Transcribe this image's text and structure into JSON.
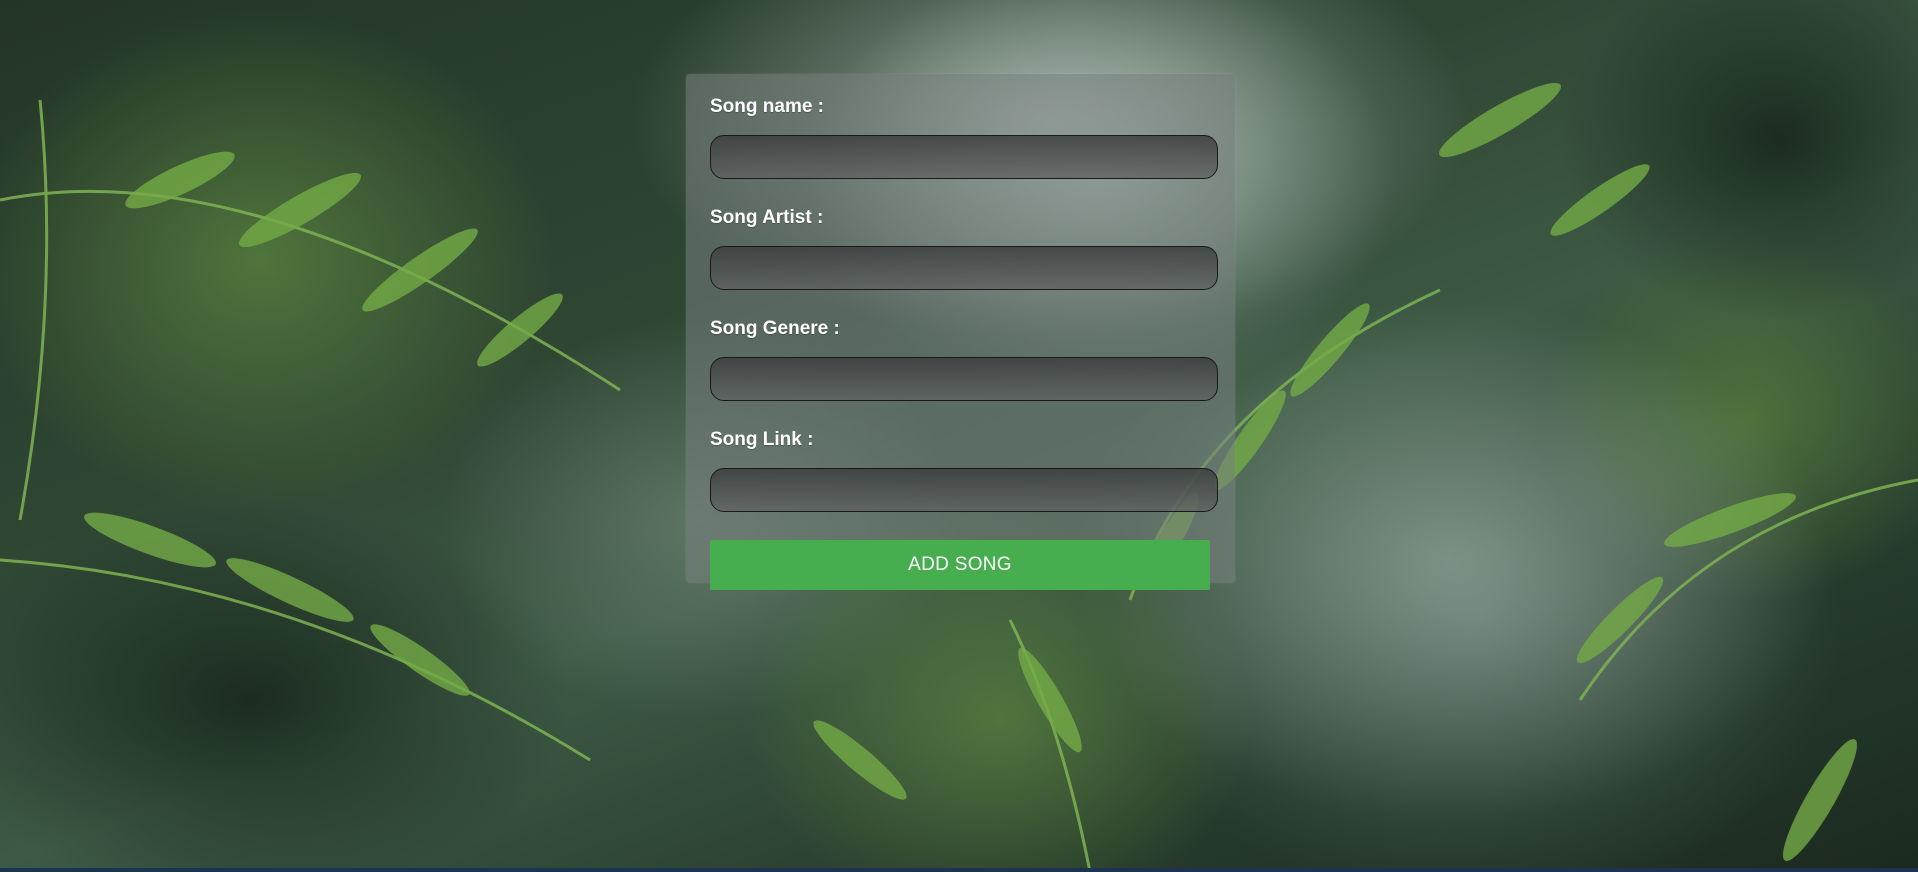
{
  "form": {
    "fields": [
      {
        "label": "Song name :",
        "value": ""
      },
      {
        "label": "Song Artist :",
        "value": ""
      },
      {
        "label": "Song Genere :",
        "value": ""
      },
      {
        "label": "Song Link :",
        "value": ""
      }
    ],
    "submit_label": "ADD SONG"
  },
  "colors": {
    "button": "#46ae4e",
    "card": "rgba(120,130,128,0.55)"
  },
  "background": {
    "icon": "fern-forest-photo"
  }
}
